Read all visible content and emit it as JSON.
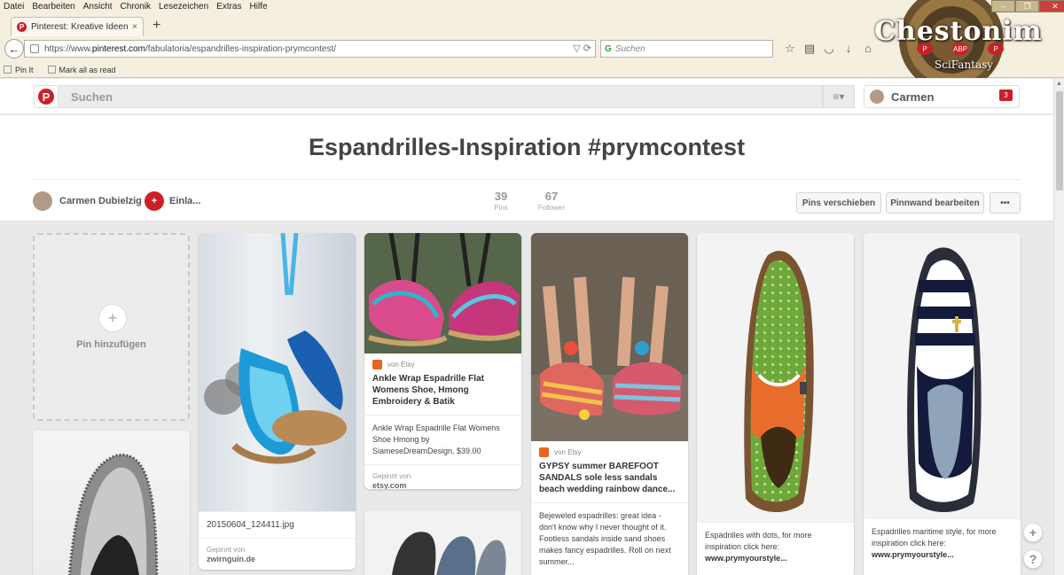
{
  "browser": {
    "menu": [
      "Datei",
      "Bearbeiten",
      "Ansicht",
      "Chronik",
      "Lesezeichen",
      "Extras",
      "Hilfe"
    ],
    "tab_title": "Pinterest: Kreative Ideen en...",
    "tab_close": "×",
    "new_tab": "+",
    "url_prefix": "https://www.",
    "url_domain": "pinterest.com",
    "url_path": "/fabulatoria/espandrilles-inspiration-prymcontest/",
    "search_placeholder": "Suchen",
    "bookmarks": [
      "Pin It",
      "Mark all as read"
    ],
    "theme_word": "Chestonim",
    "theme_sub": "SciFantasy",
    "addon_badge": "ABP"
  },
  "header": {
    "search_placeholder": "Suchen",
    "user_name": "Carmen",
    "notifications": "3"
  },
  "board": {
    "title": "Espandrilles-Inspiration #prymcontest",
    "owner": "Carmen Dubielzig",
    "invite": "Einla...",
    "pins_count": "39",
    "pins_label": "Pins",
    "followers_count": "67",
    "followers_label": "Follower",
    "move_pins": "Pins verschieben",
    "edit_board": "Pinnwand bearbeiten",
    "more": "•••"
  },
  "add_pin_label": "Pin hinzufügen",
  "pins": [
    {
      "caption": "20150604_124411.jpg",
      "saved_label": "Gepinnt von",
      "saved_from": "zwirnguin.de"
    },
    {
      "via": "von Etsy",
      "title": "Ankle Wrap Espadrille Flat Womens Shoe, Hmong Embroidery & Batik",
      "desc": "Ankle Wrap Espadrille Flat Womens Shoe Hmong by SiameseDreamDesign, $39.00",
      "saved_label": "Gepinnt von",
      "saved_from": "etsy.com"
    },
    {
      "via": "von Etsy",
      "title": "GYPSY summer BAREFOOT SANDALS sole less sandals beach wedding rainbow dance...",
      "desc": "Bejeweled espadrilles: great idea - don't know why I never thought of it. Footless sandals inside sand shoes makes fancy espadrilles. Roll on next summer..."
    },
    {
      "desc": "Espadrilles with dots, for more inspiration click here:",
      "link": "www.prymyourstyle..."
    },
    {
      "desc": "Espadrilles maritime style, for more inspiration click here:",
      "link": "www.prymyourstyle..."
    }
  ],
  "fab_plus": "+",
  "fab_help": "?"
}
